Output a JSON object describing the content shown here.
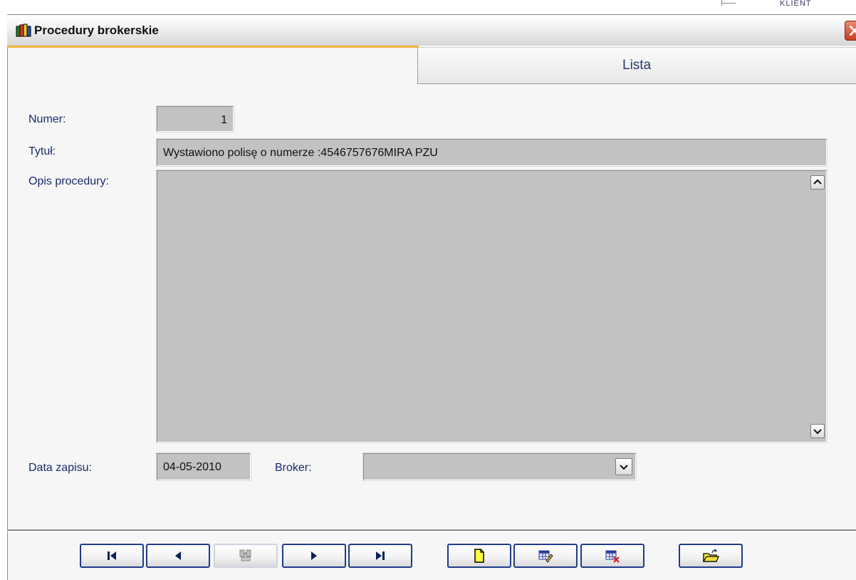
{
  "background": {
    "partial_text": "KLIENT"
  },
  "window": {
    "title": "Procedury brokerskie",
    "icon": "app-books-icon",
    "close_icon": "close-icon"
  },
  "tabs": [
    {
      "label": "",
      "active": true
    },
    {
      "label": "Lista",
      "active": false
    }
  ],
  "form": {
    "numer_label": "Numer:",
    "numer_value": "1",
    "tytul_label": "Tytuł:",
    "tytul_value": "Wystawiono polisę o numerze :4546757676MIRA PZU",
    "opis_label": "Opis procedury:",
    "opis_value": "",
    "data_label": "Data zapisu:",
    "data_value": "04-05-2010",
    "broker_label": "Broker:",
    "broker_value": ""
  },
  "toolbar": {
    "buttons": [
      {
        "name": "first-record-button",
        "icon": "first-icon",
        "enabled": true
      },
      {
        "name": "previous-record-button",
        "icon": "previous-icon",
        "enabled": true
      },
      {
        "name": "find-record-button",
        "icon": "binoculars-icon",
        "enabled": false
      },
      {
        "name": "next-record-button",
        "icon": "next-icon",
        "enabled": true
      },
      {
        "name": "last-record-button",
        "icon": "last-icon",
        "enabled": true
      },
      {
        "name": "new-record-button",
        "icon": "new-document-icon",
        "enabled": true
      },
      {
        "name": "edit-record-button",
        "icon": "edit-grid-icon",
        "enabled": true
      },
      {
        "name": "delete-record-button",
        "icon": "delete-grid-icon",
        "enabled": true
      },
      {
        "name": "close-form-button",
        "icon": "open-folder-icon",
        "enabled": true
      }
    ]
  },
  "colors": {
    "label_text": "#1a2a6b",
    "field_bg": "#c2c2c2",
    "button_border": "#1f3c8a",
    "active_tab_accent": "#f2b23a",
    "close_button": "#c5401f"
  }
}
